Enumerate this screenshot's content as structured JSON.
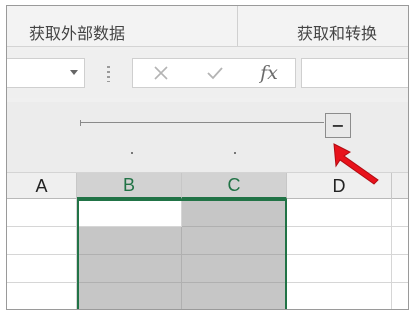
{
  "ribbon": {
    "group_left": "获取外部数据",
    "group_right": "获取和转换"
  },
  "formula_bar": {
    "cancel_icon": "close-icon",
    "enter_icon": "check-icon",
    "function_label": "fx",
    "name_box_value": "",
    "formula_value": ""
  },
  "outline": {
    "collapse_label": "−"
  },
  "columns": [
    "A",
    "B",
    "C",
    "D"
  ],
  "selected_columns": [
    "B",
    "C"
  ],
  "colors": {
    "selection_accent": "#217346",
    "selected_fill": "#c6c6c6",
    "pointer": "#e8121b"
  }
}
